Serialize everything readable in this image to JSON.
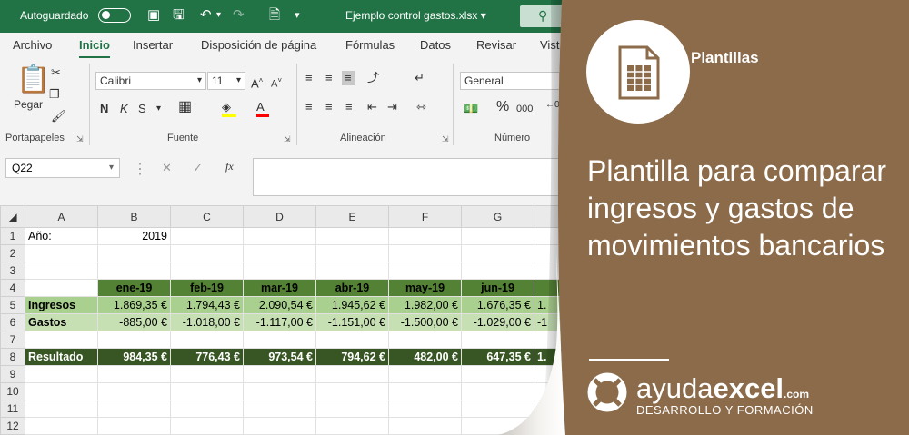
{
  "titlebar": {
    "autosave_label": "Autoguardado",
    "filename": "Ejemplo control gastos.xlsx",
    "dropdown_glyph": "▾"
  },
  "tabs": [
    "Archivo",
    "Inicio",
    "Insertar",
    "Disposición de página",
    "Fórmulas",
    "Datos",
    "Revisar",
    "Vist"
  ],
  "ribbon": {
    "paste_label": "Pegar",
    "font_name": "Calibri",
    "font_size": "11",
    "bold": "N",
    "italic": "K",
    "underline": "S",
    "number_format": "General",
    "groups": [
      "Portapapeles",
      "Fuente",
      "Alineación",
      "Número"
    ]
  },
  "formula_bar": {
    "cell_ref": "Q22",
    "fx": "fx",
    "cancel": "✕",
    "confirm": "✓"
  },
  "sheet": {
    "col_headers": [
      "A",
      "B",
      "C",
      "D",
      "E",
      "F",
      "G",
      "H"
    ],
    "rows": [
      {
        "n": "1",
        "cells": [
          "Año:",
          "2019",
          "",
          "",
          "",
          "",
          "",
          ""
        ]
      },
      {
        "n": "2",
        "cells": [
          "",
          "",
          "",
          "",
          "",
          "",
          "",
          ""
        ]
      },
      {
        "n": "3",
        "cells": [
          "",
          "",
          "",
          "",
          "",
          "",
          "",
          ""
        ]
      },
      {
        "n": "4",
        "cells": [
          "",
          "ene-19",
          "feb-19",
          "mar-19",
          "abr-19",
          "may-19",
          "jun-19",
          "ju"
        ]
      },
      {
        "n": "5",
        "cells": [
          "Ingresos",
          "1.869,35 €",
          "1.794,43 €",
          "2.090,54 €",
          "1.945,62 €",
          "1.982,00 €",
          "1.676,35 €",
          "1."
        ]
      },
      {
        "n": "6",
        "cells": [
          "Gastos",
          "-885,00 €",
          "-1.018,00 €",
          "-1.117,00 €",
          "-1.151,00 €",
          "-1.500,00 €",
          "-1.029,00 €",
          "-1"
        ]
      },
      {
        "n": "7",
        "cells": [
          "",
          "",
          "",
          "",
          "",
          "",
          "",
          ""
        ]
      },
      {
        "n": "8",
        "cells": [
          "Resultado",
          "984,35 €",
          "776,43 €",
          "973,54 €",
          "794,62 €",
          "482,00 €",
          "647,35 €",
          "1."
        ]
      },
      {
        "n": "9",
        "cells": [
          "",
          "",
          "",
          "",
          "",
          "",
          "",
          ""
        ]
      },
      {
        "n": "10",
        "cells": [
          "",
          "",
          "",
          "",
          "",
          "",
          "",
          ""
        ]
      },
      {
        "n": "11",
        "cells": [
          "",
          "",
          "",
          "",
          "",
          "",
          "",
          ""
        ]
      },
      {
        "n": "12",
        "cells": [
          "",
          "",
          "",
          "",
          "",
          "",
          "",
          ""
        ]
      }
    ]
  },
  "banner": {
    "category": "Plantillas",
    "title": "Plantilla para comparar ingresos y gastos de movimientos bancarios",
    "brand_light": "ayuda",
    "brand_bold": "excel",
    "brand_tld": ".com",
    "brand_sub": "DESARROLLO Y FORMACIÓN",
    "colors": {
      "panel": "#8c6b4a",
      "excel_green": "#217346",
      "header_green": "#548235",
      "income_green": "#a9d08e",
      "expense_green": "#c6e0b4",
      "result_green": "#375623"
    }
  }
}
